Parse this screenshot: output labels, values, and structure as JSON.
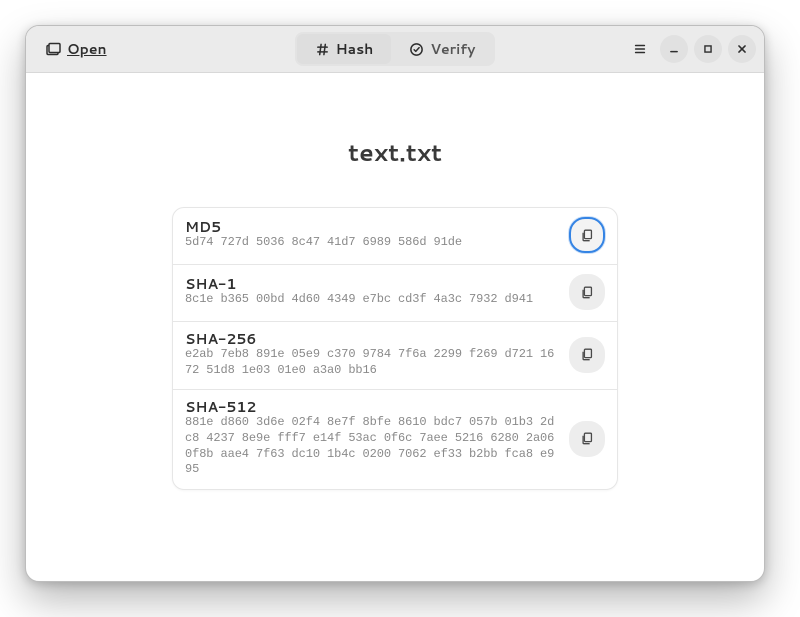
{
  "header": {
    "open_label": "Open",
    "tabs": {
      "hash_label": "Hash",
      "verify_label": "Verify"
    }
  },
  "file": {
    "name": "text.txt"
  },
  "hashes": [
    {
      "algo": "MD5",
      "digest": "5d74 727d 5036 8c47 41d7 6989 586d 91de",
      "focused": true
    },
    {
      "algo": "SHA-1",
      "digest": "8c1e b365 00bd 4d60 4349 e7bc cd3f 4a3c 7932 d941",
      "focused": false
    },
    {
      "algo": "SHA-256",
      "digest": "e2ab 7eb8 891e 05e9 c370 9784 7f6a 2299 f269 d721 1672 51d8 1e03 01e0 a3a0 bb16",
      "focused": false
    },
    {
      "algo": "SHA-512",
      "digest": "881e d860 3d6e 02f4 8e7f 8bfe 8610 bdc7 057b 01b3 2dc8 4237 8e9e fff7 e14f 53ac 0f6c 7aee 5216 6280 2a06 0f8b aae4 7f63 dc10 1b4c 0200 7062 ef33 b2bb fca8 e995",
      "focused": false
    }
  ]
}
